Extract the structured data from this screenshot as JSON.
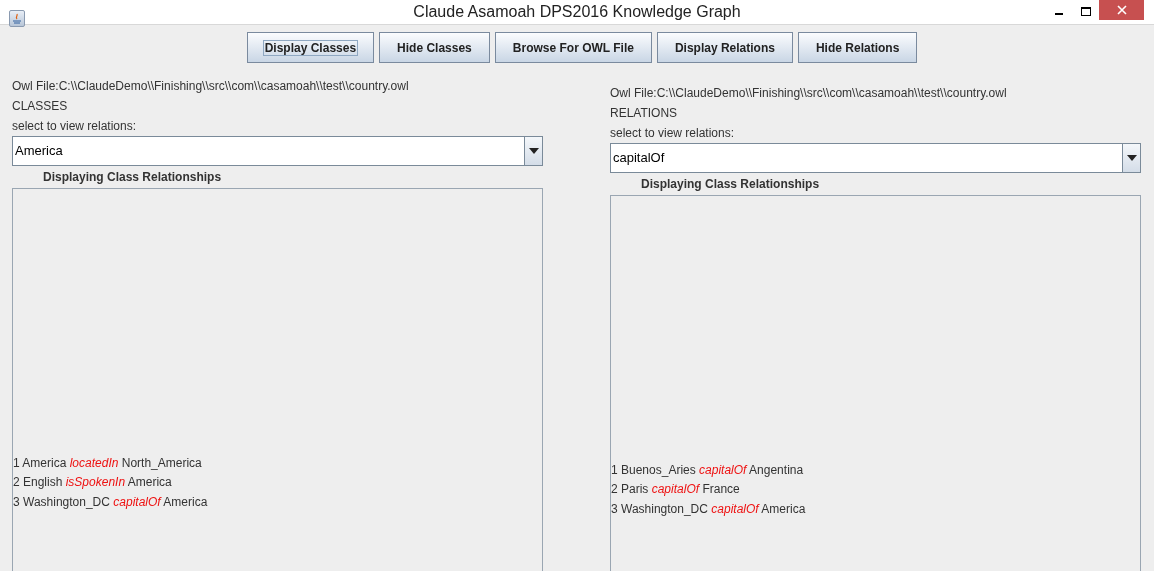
{
  "window": {
    "title": "Claude Asamoah DPS2016 Knowledge Graph"
  },
  "buttons": [
    {
      "label": "Display Classes",
      "focused": true
    },
    {
      "label": "Hide Classes",
      "focused": false
    },
    {
      "label": "Browse For OWL File",
      "focused": false
    },
    {
      "label": "Display Relations",
      "focused": false
    },
    {
      "label": "Hide Relations",
      "focused": false
    }
  ],
  "panels": [
    {
      "file": "Owl File:C:\\\\ClaudeDemo\\\\Finishing\\\\src\\\\com\\\\casamoah\\\\test\\\\country.owl",
      "heading": "CLASSES",
      "prompt": "select to view relations:",
      "selection": "America",
      "caption": "Displaying Class Relationships",
      "lines": [
        "1 America *locatedIn* North_America",
        "2 English *isSpokenIn* America",
        "3 Washington_DC *capitalOf* America"
      ]
    },
    {
      "file": "Owl File:C:\\\\ClaudeDemo\\\\Finishing\\\\src\\\\com\\\\casamoah\\\\test\\\\country.owl",
      "heading": "RELATIONS",
      "prompt": "select to view relations:",
      "selection": "capitalOf",
      "caption": "Displaying Class Relationships",
      "lines": [
        "1 Buenos_Aries *capitalOf* Angentina",
        "2 Paris *capitalOf* France",
        "3 Washington_DC *capitalOf* America"
      ]
    }
  ]
}
